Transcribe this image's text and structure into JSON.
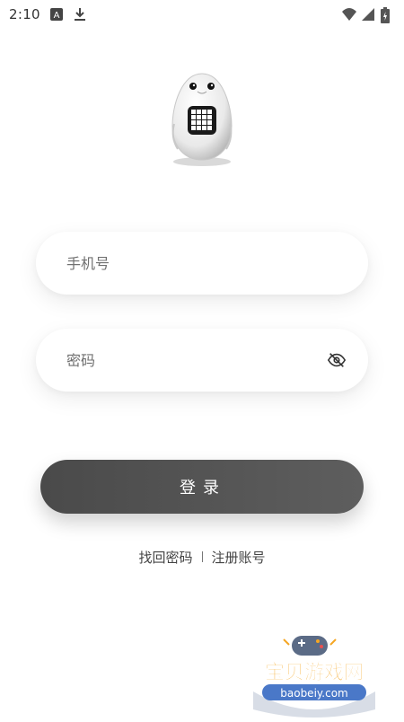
{
  "status_bar": {
    "time": "2:10",
    "icons": [
      "a-icon",
      "download-icon",
      "wifi-icon",
      "signal-icon",
      "battery-icon"
    ]
  },
  "logo": {
    "name": "egg-robot-logo"
  },
  "phone_field": {
    "placeholder": "手机号",
    "value": ""
  },
  "password_field": {
    "placeholder": "密码",
    "value": "",
    "toggle_icon": "eye-off-icon"
  },
  "login_button": {
    "label": "登录"
  },
  "links": {
    "forgot_password": "找回密码",
    "register": "注册账号"
  },
  "watermark": {
    "title": "宝贝游戏网",
    "url": "baobeiy.com"
  },
  "colors": {
    "button": "#555555",
    "background": "#ffffff",
    "watermark_orange": "#f5a623"
  }
}
